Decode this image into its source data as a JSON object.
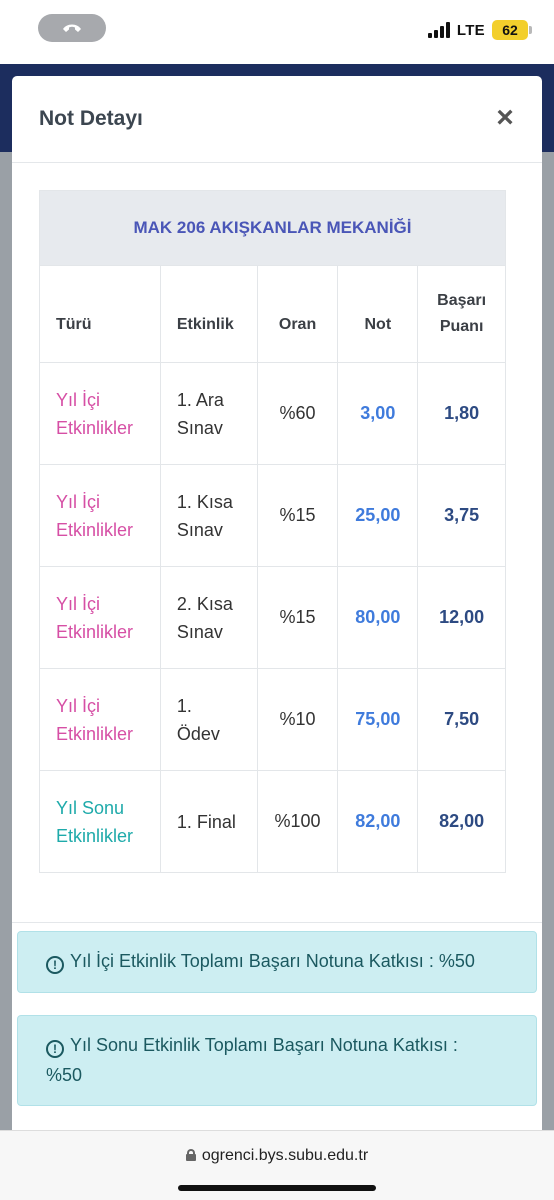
{
  "status_bar": {
    "network": "LTE",
    "battery": "62",
    "call_icon": "phone-icon"
  },
  "modal": {
    "title": "Not Detayı",
    "close_symbol": "×"
  },
  "course": {
    "name": "MAK 206 AKIŞKANLAR MEKANİĞİ"
  },
  "table": {
    "headers": {
      "type": "Türü",
      "activity": "Etkinlik",
      "rate": "Oran",
      "grade": "Not",
      "score_line1": "Başarı",
      "score_line2": "Puanı"
    },
    "rows": [
      {
        "type_line1": "Yıl İçi",
        "type_line2": "Etkinlikler",
        "activity_line1": "1. Ara",
        "activity_line2": "Sınav",
        "rate": "%60",
        "grade": "3,00",
        "score": "1,80",
        "type_color": "#d64fa5"
      },
      {
        "type_line1": "Yıl İçi",
        "type_line2": "Etkinlikler",
        "activity_line1": "1. Kısa",
        "activity_line2": "Sınav",
        "rate": "%15",
        "grade": "25,00",
        "score": "3,75",
        "type_color": "#d64fa5"
      },
      {
        "type_line1": "Yıl İçi",
        "type_line2": "Etkinlikler",
        "activity_line1": "2. Kısa",
        "activity_line2": "Sınav",
        "rate": "%15",
        "grade": "80,00",
        "score": "12,00",
        "type_color": "#d64fa5"
      },
      {
        "type_line1": "Yıl İçi",
        "type_line2": "Etkinlikler",
        "activity_line1": "1.",
        "activity_line2": "Ödev",
        "rate": "%10",
        "grade": "75,00",
        "score": "7,50",
        "type_color": "#d64fa5"
      },
      {
        "type_line1": "Yıl Sonu",
        "type_line2": "Etkinlikler",
        "activity_line1": "1. Final",
        "activity_line2": "",
        "rate": "%100",
        "grade": "82,00",
        "score": "82,00",
        "type_color": "#1eaaaa"
      }
    ]
  },
  "alerts": {
    "icon": "!",
    "in_year": "Yıl İçi Etkinlik Toplamı Başarı Notuna Katkısı : %50",
    "end_year_line1": "Yıl Sonu Etkinlik Toplamı Başarı Notuna Katkısı :",
    "end_year_line2": "%50"
  },
  "browser": {
    "url": "ogrenci.bys.subu.edu.tr"
  },
  "colors": {
    "header_navy": "#1c2d5e",
    "course_title": "#4a56b7",
    "grade_blue": "#3f7bdc",
    "alert_bg": "#cdeef2"
  }
}
